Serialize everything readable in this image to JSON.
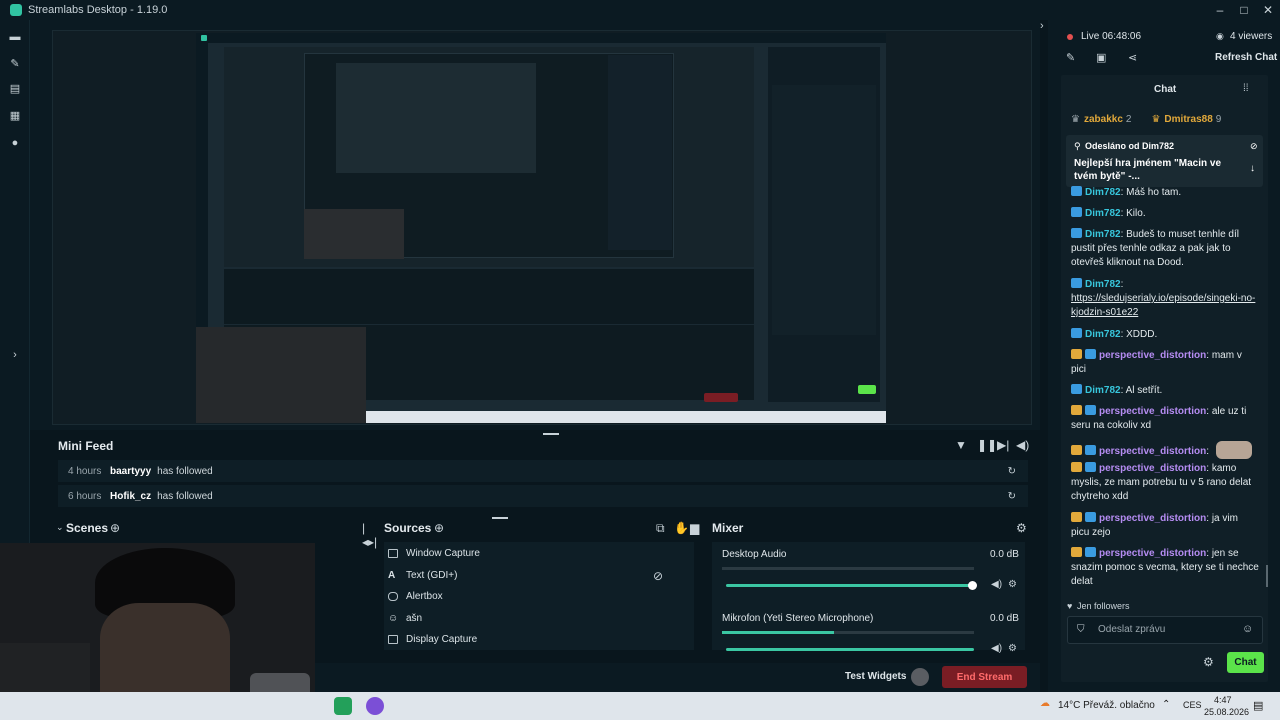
{
  "window": {
    "title": "Streamlabs Desktop - 1.19.0",
    "controls": [
      "–",
      "□",
      "✕"
    ]
  },
  "nav": {
    "icons": [
      "editor-icon",
      "themes-icon",
      "store-icon",
      "layout-icon",
      "live-icon"
    ]
  },
  "minifeed": {
    "title": "Mini Feed",
    "events": [
      {
        "time": "4 hours",
        "user": "baartyyy",
        "action": "has followed"
      },
      {
        "time": "6 hours",
        "user": "Hofik_cz",
        "action": "has followed"
      }
    ]
  },
  "scenes": {
    "title": "Scenes"
  },
  "sources": {
    "title": "Sources",
    "items": [
      {
        "label": "Window Capture",
        "icon": "window-icon"
      },
      {
        "label": "Text (GDI+)",
        "icon": "text-icon"
      },
      {
        "label": "Alertbox",
        "icon": "alert-icon"
      },
      {
        "label": "ašn",
        "icon": "person-icon"
      },
      {
        "label": "Display Capture",
        "icon": "display-icon"
      }
    ]
  },
  "mixer": {
    "title": "Mixer",
    "channels": [
      {
        "name": "Desktop Audio",
        "db": "0.0 dB",
        "level": 0.97
      },
      {
        "name": "Mikrofon (Yeti Stereo Microphone)",
        "db": "0.0 dB",
        "level": 0.9
      }
    ]
  },
  "footer": {
    "test_widgets": "Test Widgets",
    "end_stream": "End Stream"
  },
  "status": {
    "live": "Live 06:48:06",
    "viewers": "4 viewers",
    "refresh": "Refresh Chat"
  },
  "chat": {
    "title": "Chat",
    "top_viewers": [
      {
        "rank": "2",
        "name": "zabakkc",
        "count": "2"
      },
      {
        "rank": "1",
        "name": "Dmitras88",
        "count": "9"
      }
    ],
    "pinned": {
      "label": "Odesláno od",
      "user": "Dim782",
      "text": "Nejlepší hra jménem \"Macin ve tvém bytě\" -..."
    },
    "messages": [
      {
        "user": "Dim782",
        "text": "Máš ho tam."
      },
      {
        "user": "Dim782",
        "text": "Kilo."
      },
      {
        "user": "Dim782",
        "text": "Budeš to muset tenhle díl pustit přes tenhle odkaz a pak jak to otevřeš kliknout na Dood."
      },
      {
        "user": "Dim782",
        "text": "https://sledujserialy.io/episode/singeki-no-kjodzin-s01e22"
      },
      {
        "user": "Dim782",
        "text": "XDDD."
      },
      {
        "user": "perspective_distortion",
        "text": "mam v pici"
      },
      {
        "user": "Dim782",
        "text": "Al setřít."
      },
      {
        "user": "perspective_distortion",
        "text": "ale uz ti seru na cokoliv xd"
      },
      {
        "user": "perspective_distortion",
        "text": ""
      },
      {
        "user": "perspective_distortion",
        "text": "kamo myslis, ze mam potrebu tu v 5 rano delat chytreho xdd"
      },
      {
        "user": "perspective_distortion",
        "text": "ja vim picu zejo"
      },
      {
        "user": "perspective_distortion",
        "text": "jen se snazim pomoc s vecma, ktery se ti nechce delat"
      }
    ],
    "followers_only": "Jen followers",
    "input_placeholder": "Odeslat zprávu",
    "send": "Chat"
  },
  "taskbar": {
    "weather": "14°C  Převáž. oblačno",
    "lang": "CES",
    "time": "4:47",
    "date": "25.08.2026"
  },
  "colors": {
    "accent": "#31c3a2",
    "end_stream": "#7a1d24",
    "chat_button": "#5be34a"
  }
}
